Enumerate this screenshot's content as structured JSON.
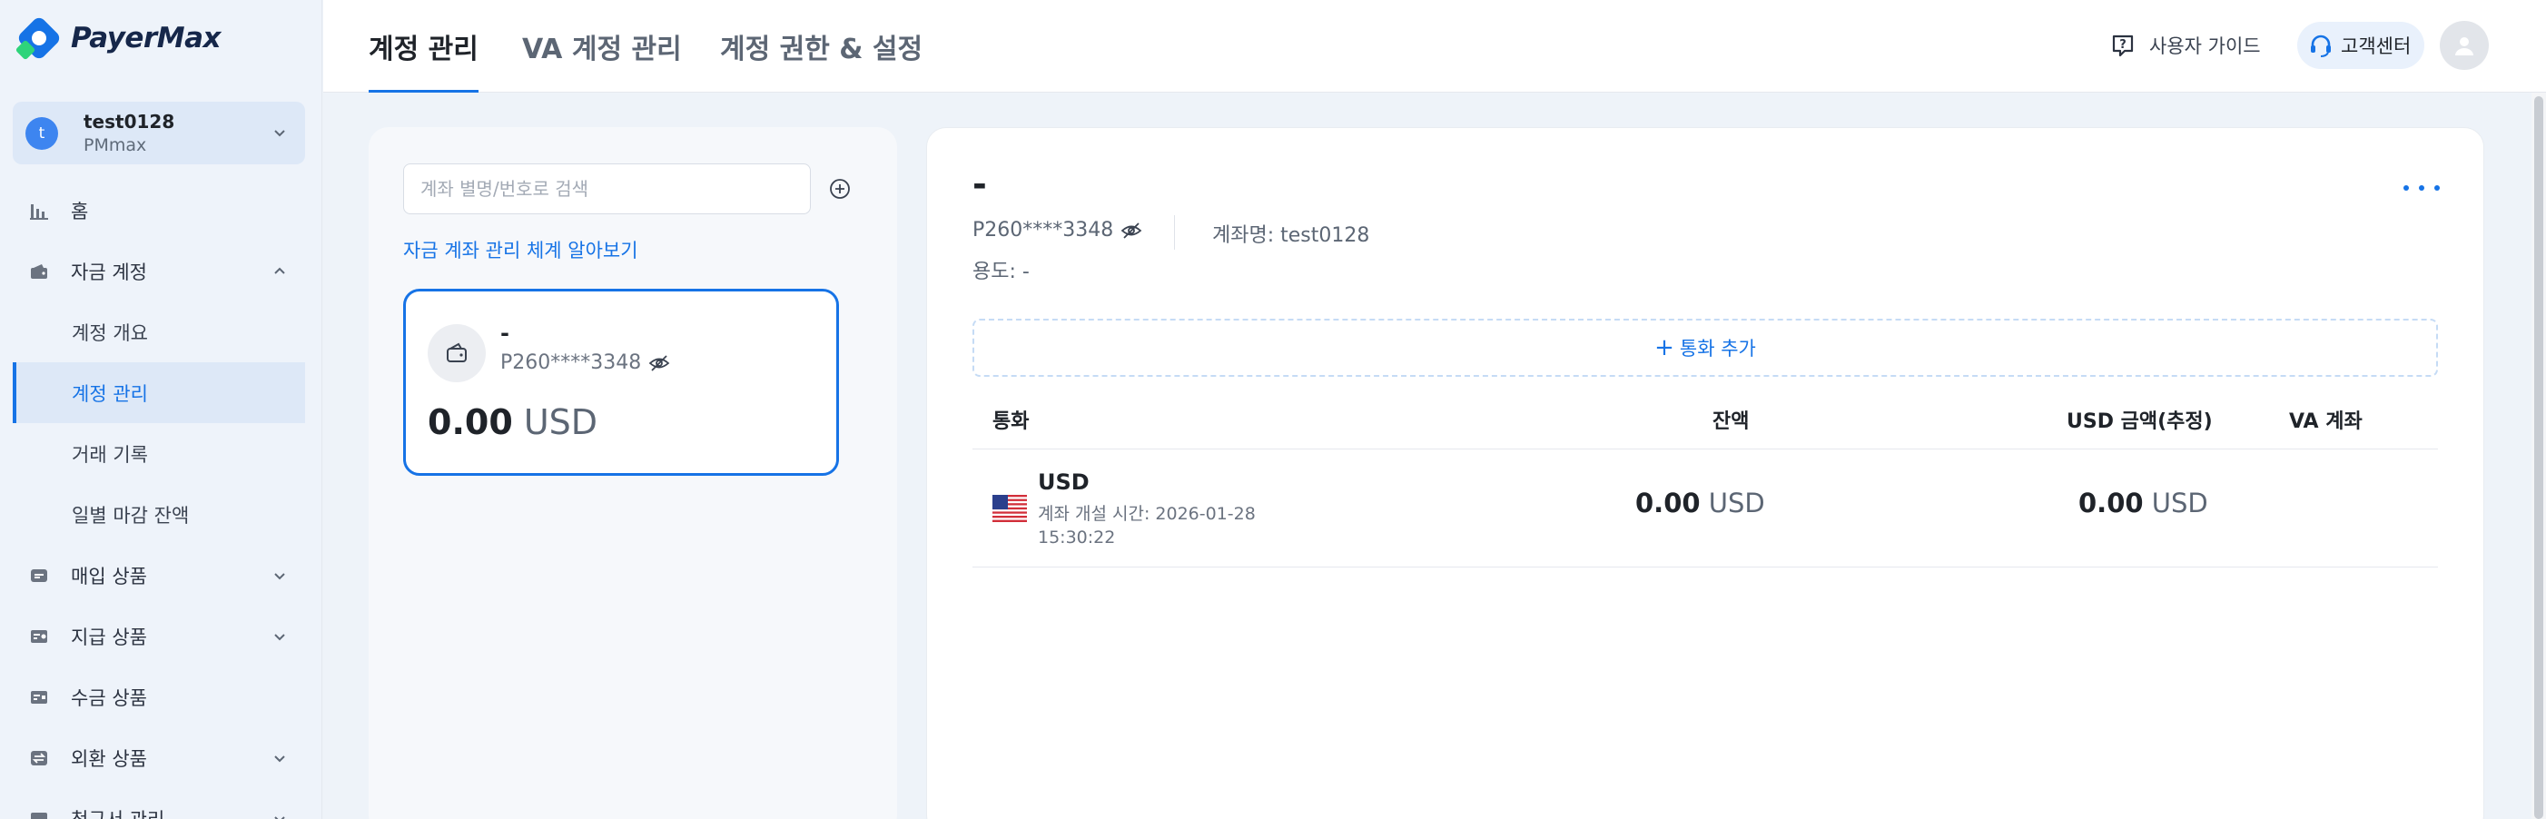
{
  "brand": {
    "name": "PayerMax"
  },
  "account_switcher": {
    "initial": "t",
    "name": "test0128",
    "org": "PMmax"
  },
  "nav": {
    "home": "홈",
    "fund_account": "자금 계정",
    "fund_sub": {
      "overview": "계정 개요",
      "management": "계정 관리",
      "transactions": "거래 기록",
      "daily_balance": "일별 마감 잔액"
    },
    "acquiring": "매입 상품",
    "payout": "지급 상품",
    "collection": "수금 상품",
    "fx": "외환 상품",
    "partial_next": "청구서 관리"
  },
  "header": {
    "tabs": [
      "계정 관리",
      "VA 계정 관리",
      "계정 권한 & 설정"
    ],
    "user_guide": "사용자 가이드",
    "customer_center": "고객센터"
  },
  "left_panel": {
    "search_placeholder": "계좌 별명/번호로 검색",
    "learn_link": "자금 계좌 관리 체계 알아보기",
    "account_tile": {
      "name": "-",
      "number": "P260****3348",
      "balance_amount": "0.00",
      "balance_currency": "USD"
    }
  },
  "detail": {
    "title": "-",
    "account_number": "P260****3348",
    "account_name": "계좌명: test0128",
    "usage": "용도: -",
    "add_currency": "통화 추가",
    "table": {
      "headers": [
        "통화",
        "잔액",
        "USD 금액(추정)",
        "VA 계좌"
      ],
      "rows": [
        {
          "currency": "USD",
          "opened_label": "계좌 개설 시간: 2026-01-28 15:30:22",
          "balance_amount": "0.00",
          "balance_currency": "USD",
          "usd_amount": "0.00",
          "usd_currency": "USD"
        }
      ]
    }
  },
  "colors": {
    "accent": "#1673e6",
    "sidebar_bg": "#eef3fa",
    "brand_green": "#2ed47a"
  },
  "icons": [
    "logo-icon",
    "chevron-down-icon",
    "chevron-up-icon",
    "bar-chart-icon",
    "wallet-icon",
    "card-icon",
    "transfer-icon",
    "exchange-icon",
    "plus-circle-icon",
    "eye-off-icon",
    "question-icon",
    "headset-icon",
    "user-icon",
    "more-icon",
    "us-flag-icon"
  ]
}
